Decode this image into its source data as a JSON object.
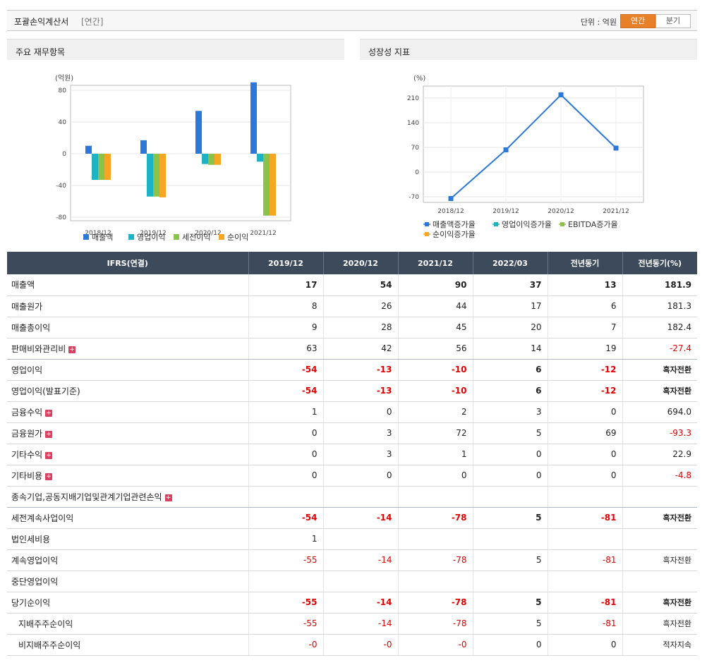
{
  "header": {
    "title": "포괄손익계산서",
    "subtitle": "[연간]",
    "unit_label": "단위 : 억원",
    "annual_btn": "연간",
    "quarter_btn": "분기"
  },
  "panels": {
    "left_title": "주요 재무항목",
    "right_title": "성장성 지표"
  },
  "chart_data": [
    {
      "type": "bar",
      "ylabel": "(억원)",
      "categories": [
        "2018/12",
        "2019/12",
        "2020/12",
        "2021/12"
      ],
      "ylim": [
        -80,
        80
      ],
      "yticks": [
        80,
        40,
        0,
        -40,
        -80
      ],
      "series": [
        {
          "name": "매출액",
          "color": "#2b78d8",
          "values": [
            10,
            17,
            54,
            90
          ]
        },
        {
          "name": "영업이익",
          "color": "#1db3c4",
          "values": [
            -33,
            -54,
            -13,
            -10
          ]
        },
        {
          "name": "세전이익",
          "color": "#8bc34a",
          "values": [
            -33,
            -54,
            -14,
            -78
          ]
        },
        {
          "name": "순이익",
          "color": "#f5a623",
          "values": [
            -33,
            -55,
            -14,
            -78
          ]
        }
      ]
    },
    {
      "type": "line",
      "ylabel": "(%)",
      "categories": [
        "2018/12",
        "2019/12",
        "2020/12",
        "2021/12"
      ],
      "ylim": [
        -70,
        210
      ],
      "yticks": [
        210,
        140,
        70,
        0,
        -70
      ],
      "series": [
        {
          "name": "매출액증가율",
          "color": "#2b78d8",
          "values": [
            -75,
            63,
            219,
            68
          ]
        },
        {
          "name": "영업이익증가율",
          "color": "#1db3c4",
          "values": []
        },
        {
          "name": "EBITDA증가율",
          "color": "#8bc34a",
          "values": []
        },
        {
          "name": "순이익증가율",
          "color": "#f5a623",
          "values": []
        }
      ]
    }
  ],
  "table": {
    "headers": [
      "IFRS(연결)",
      "2019/12",
      "2020/12",
      "2021/12",
      "2022/03",
      "전년동기",
      "전년동기(%)"
    ],
    "rows": [
      {
        "label": "매출액",
        "values": [
          "17",
          "54",
          "90",
          "37",
          "13",
          "181.9"
        ]
      },
      {
        "label": "매출원가",
        "values": [
          "8",
          "26",
          "44",
          "17",
          "6",
          "181.3"
        ]
      },
      {
        "label": "매출총이익",
        "values": [
          "9",
          "28",
          "45",
          "20",
          "7",
          "182.4"
        ]
      },
      {
        "label": "판매비와관리비",
        "values": [
          "63",
          "42",
          "56",
          "14",
          "19",
          "-27.4"
        ]
      },
      {
        "label": "영업이익",
        "values": [
          "-54",
          "-13",
          "-10",
          "6",
          "-12",
          "흑자전환"
        ]
      },
      {
        "label": "영업이익(발표기준)",
        "values": [
          "-54",
          "-13",
          "-10",
          "6",
          "-12",
          "흑자전환"
        ]
      },
      {
        "label": "금융수익",
        "values": [
          "1",
          "0",
          "2",
          "3",
          "0",
          "694.0"
        ]
      },
      {
        "label": "금융원가",
        "values": [
          "0",
          "3",
          "72",
          "5",
          "69",
          "-93.3"
        ]
      },
      {
        "label": "기타수익",
        "values": [
          "0",
          "3",
          "1",
          "0",
          "0",
          "22.9"
        ]
      },
      {
        "label": "기타비용",
        "values": [
          "0",
          "0",
          "0",
          "0",
          "0",
          "-4.8"
        ]
      },
      {
        "label": "종속기업,공동지배기업및관계기업관련손익",
        "values": [
          "",
          "",
          "",
          "",
          "",
          ""
        ]
      },
      {
        "label": "세전계속사업이익",
        "values": [
          "-54",
          "-14",
          "-78",
          "5",
          "-81",
          "흑자전환"
        ]
      },
      {
        "label": "법인세비용",
        "values": [
          "1",
          "",
          "",
          "",
          "",
          ""
        ]
      },
      {
        "label": "계속영업이익",
        "values": [
          "-55",
          "-14",
          "-78",
          "5",
          "-81",
          "흑자전환"
        ]
      },
      {
        "label": "중단영업이익",
        "values": [
          "",
          "",
          "",
          "",
          "",
          ""
        ]
      },
      {
        "label": "당기순이익",
        "values": [
          "-55",
          "-14",
          "-78",
          "5",
          "-81",
          "흑자전환"
        ]
      },
      {
        "label": "지배주주순이익",
        "values": [
          "-55",
          "-14",
          "-78",
          "5",
          "-81",
          "흑자전환"
        ]
      },
      {
        "label": "비지배주주순이익",
        "values": [
          "-0",
          "-0",
          "-0",
          "0",
          "0",
          "적자지속"
        ]
      }
    ]
  }
}
